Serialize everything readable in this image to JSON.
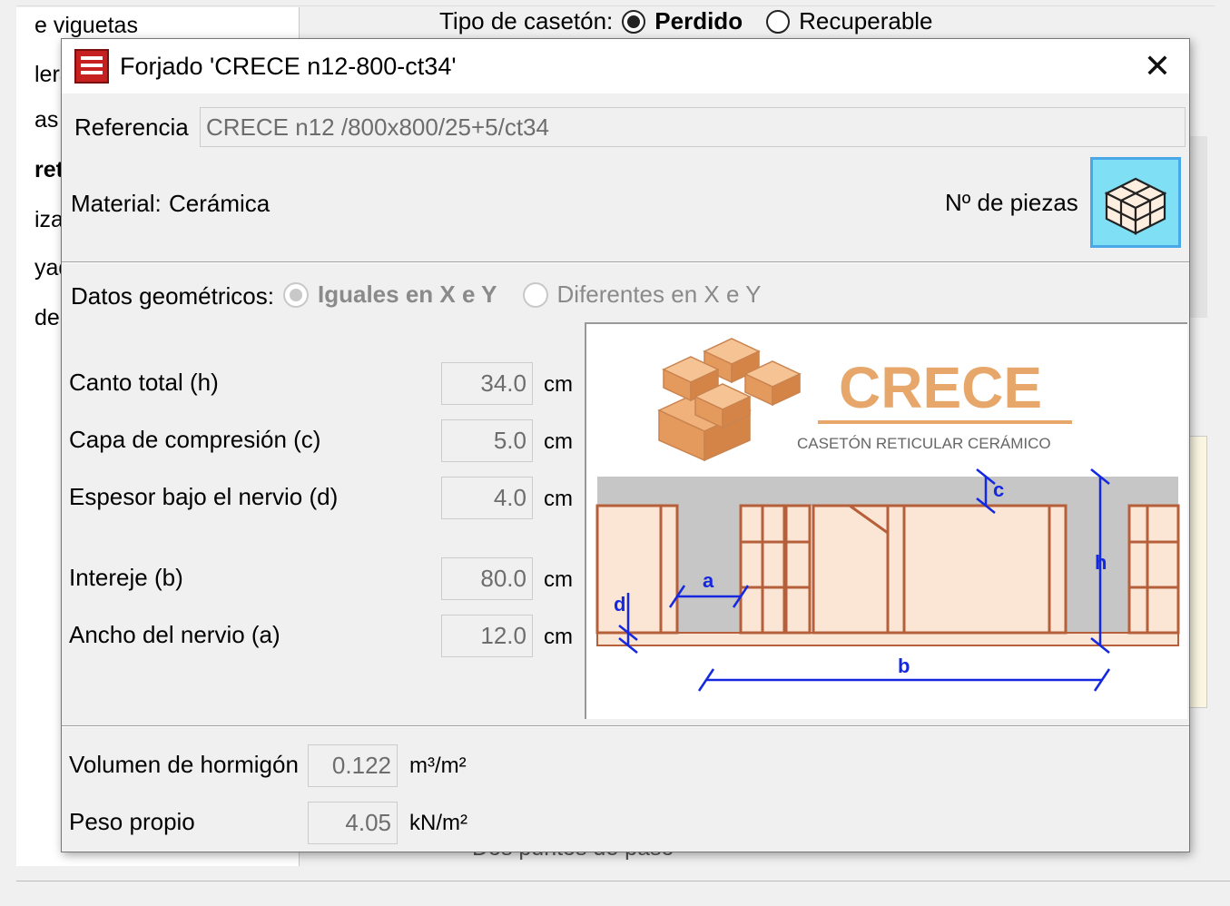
{
  "background": {
    "left_items": [
      "e viguetas",
      "lerad",
      "as",
      "reti",
      "izas",
      "yada",
      "de c"
    ],
    "caseton_label": "Tipo de casetón:",
    "caseton_options": [
      "Perdido",
      "Recuperable"
    ],
    "bottom_text": "Dos puntos de paso"
  },
  "dialog": {
    "title": "Forjado 'CRECE n12-800-ct34'",
    "close_symbol": "✕",
    "referencia_label": "Referencia",
    "referencia_value": "CRECE n12 /800x800/25+5/ct34",
    "material_label": "Material:",
    "material_value": "Cerámica",
    "piezas_label": "Nº de piezas",
    "datos_label": "Datos geométricos:",
    "datos_options": [
      "Iguales en X e Y",
      "Diferentes en X e Y"
    ],
    "fields": [
      {
        "label": "Canto total (h)",
        "value": "34.0",
        "unit": "cm"
      },
      {
        "label": "Capa de compresión (c)",
        "value": "5.0",
        "unit": "cm"
      },
      {
        "label": "Espesor bajo el nervio (d)",
        "value": "4.0",
        "unit": "cm"
      },
      {
        "label": "Intereje (b)",
        "value": "80.0",
        "unit": "cm"
      },
      {
        "label": "Ancho del nervio (a)",
        "value": "12.0",
        "unit": "cm"
      }
    ],
    "results": [
      {
        "label": "Volumen de hormigón",
        "value": "0.122",
        "unit": "m³/m²"
      },
      {
        "label": "Peso propio",
        "value": "4.05",
        "unit": "kN/m²"
      }
    ],
    "diagram": {
      "brand": "CRECE",
      "subtitle": "CASETÓN RETICULAR CERÁMICO",
      "labels": {
        "a": "a",
        "b": "b",
        "c": "c",
        "d": "d",
        "h": "h"
      }
    }
  },
  "colors": {
    "brand_orange": "#e8a76a",
    "brick_stroke": "#b5603a",
    "brick_fill": "#fbe6d6",
    "concrete": "#c6c6c6",
    "dimension_blue": "#1428e0",
    "pieces_button": "#7fdff5"
  }
}
